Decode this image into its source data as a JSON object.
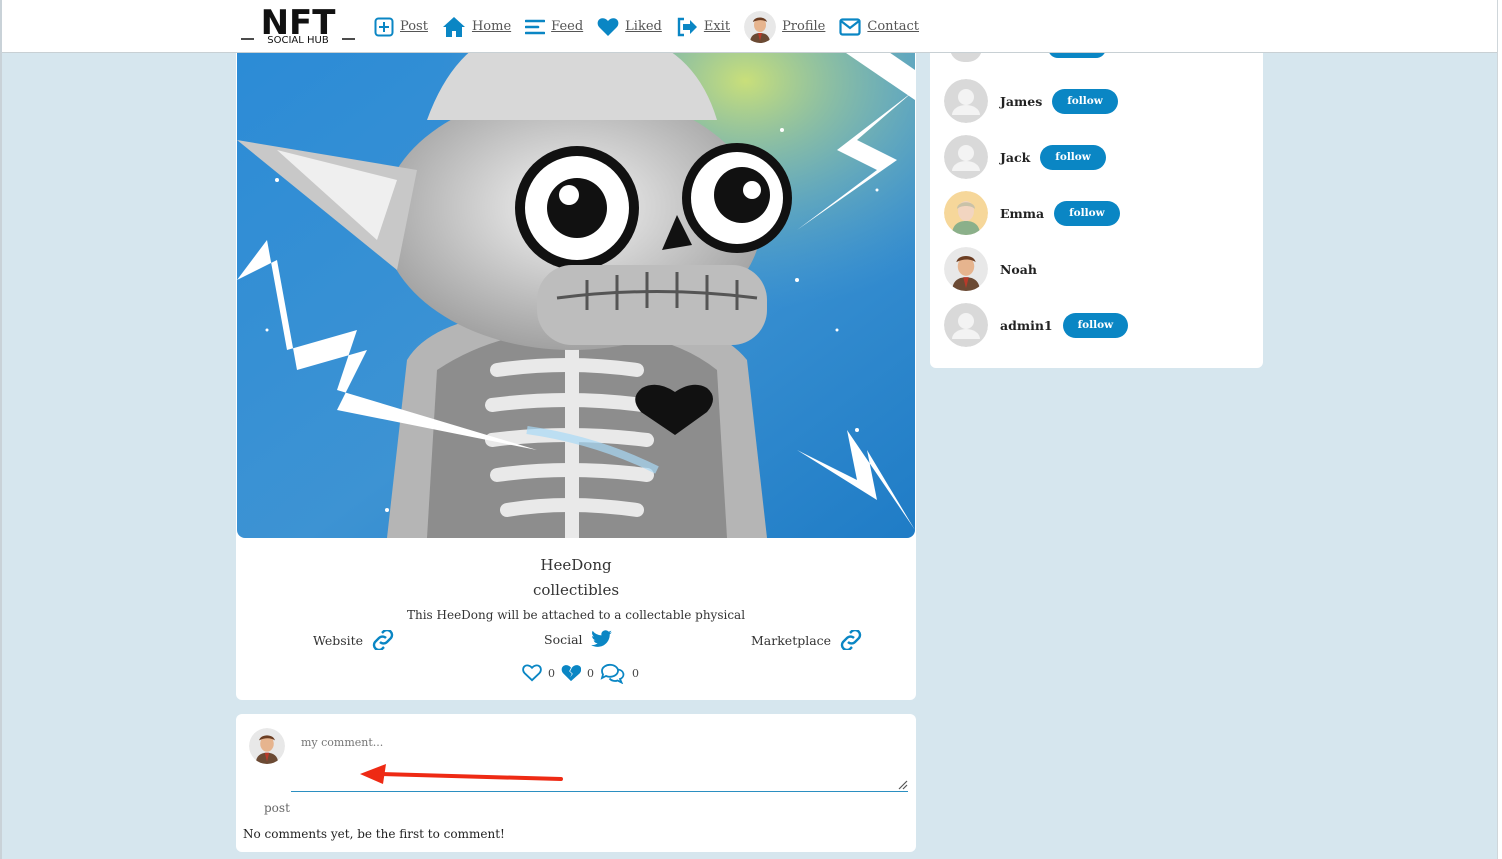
{
  "header": {
    "logo_top": "NFT",
    "logo_sub": "SOCIAL HUB",
    "nav": [
      {
        "label": "Post",
        "icon": "plus-square-icon"
      },
      {
        "label": "Home",
        "icon": "home-icon"
      },
      {
        "label": "Feed",
        "icon": "feed-lines-icon"
      },
      {
        "label": "Liked",
        "icon": "heart-icon"
      },
      {
        "label": "Exit",
        "icon": "exit-icon"
      },
      {
        "label": "Profile",
        "icon": "avatar"
      },
      {
        "label": "Contact",
        "icon": "envelope-icon"
      }
    ]
  },
  "post": {
    "title": "HeeDong",
    "category": "collectibles",
    "description": "This HeeDong will be attached to a collectable physical",
    "links": {
      "website": "Website",
      "social": "Social",
      "marketplace": "Marketplace"
    },
    "likes": "0",
    "dislikes": "0",
    "comments": "0"
  },
  "comment_box": {
    "placeholder": "my comment...",
    "post_label": "post",
    "empty_text": "No comments yet, be the first to comment!"
  },
  "sidebar": {
    "users": [
      {
        "name": "James",
        "follow": "follow"
      },
      {
        "name": "Jack",
        "follow": "follow"
      },
      {
        "name": "Emma",
        "follow": "follow"
      },
      {
        "name": "Noah",
        "follow": ""
      },
      {
        "name": "admin1",
        "follow": "follow"
      }
    ]
  },
  "colors": {
    "accent": "#0a86c4",
    "page_bg": "#d6e6ee",
    "arrow": "#ee2a14"
  }
}
